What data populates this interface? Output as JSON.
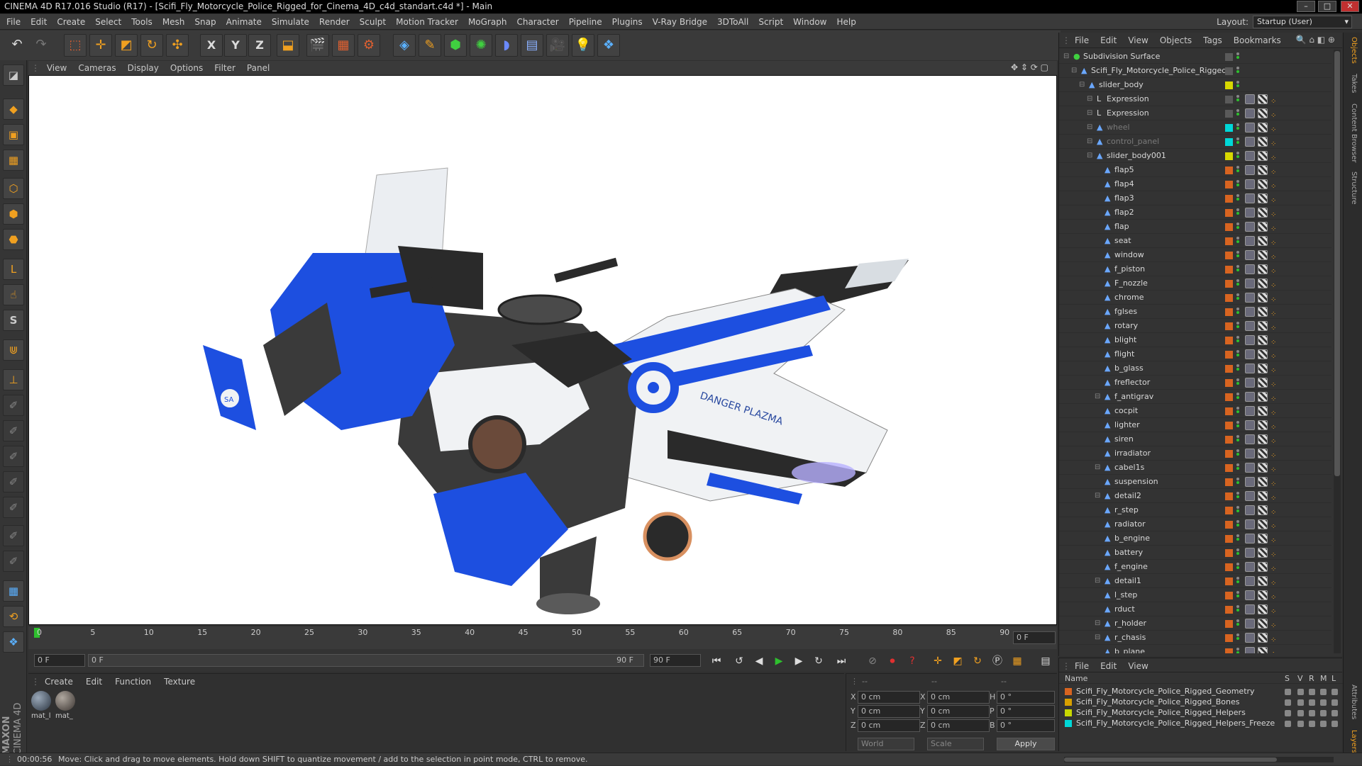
{
  "window": {
    "title": "CINEMA 4D R17.016 Studio (R17) - [Scifi_Fly_Motorcycle_Police_Rigged_for_Cinema_4D_c4d_standart.c4d *] - Main"
  },
  "menu": [
    "File",
    "Edit",
    "Create",
    "Select",
    "Tools",
    "Mesh",
    "Snap",
    "Animate",
    "Simulate",
    "Render",
    "Sculpt",
    "Motion Tracker",
    "MoGraph",
    "Character",
    "Pipeline",
    "Plugins",
    "V-Ray Bridge",
    "3DToAll",
    "Script",
    "Window",
    "Help"
  ],
  "layout": {
    "label": "Layout:",
    "value": "Startup (User)"
  },
  "toolbar": {
    "x": "X",
    "y": "Y",
    "z": "Z"
  },
  "lefttools": {
    "s_label": "S"
  },
  "viewport_menu": [
    "View",
    "Cameras",
    "Display",
    "Options",
    "Filter",
    "Panel"
  ],
  "timeline": {
    "ticks": [
      "0",
      "5",
      "10",
      "15",
      "20",
      "25",
      "30",
      "35",
      "40",
      "45",
      "50",
      "55",
      "60",
      "65",
      "70",
      "75",
      "80",
      "85",
      "90"
    ],
    "end_field": "0 F"
  },
  "playback": {
    "start_field": "0 F",
    "range_start": "0 F",
    "range_end": "90 F",
    "end_field": "90 F"
  },
  "material_menu": [
    "Create",
    "Edit",
    "Function",
    "Texture"
  ],
  "materials": [
    "mat_l",
    "mat_"
  ],
  "coords": {
    "x_pos": "0 cm",
    "y_pos": "0 cm",
    "z_pos": "0 cm",
    "x_size": "0 cm",
    "y_size": "0 cm",
    "z_size": "0 cm",
    "h": "0 °",
    "p": "0 °",
    "b": "0 °",
    "mode": "World",
    "scale": "Scale",
    "apply": "Apply",
    "dashes1": "--",
    "dashes2": "--",
    "dashes3": "--"
  },
  "objects_menu": [
    "File",
    "Edit",
    "View",
    "Objects",
    "Tags",
    "Bookmarks"
  ],
  "objects": [
    {
      "name": "Subdivision Surface",
      "indent": 0,
      "color": "#5a5a5a",
      "grey": false
    },
    {
      "name": "Scifi_Fly_Motorcycle_Police_Rigged",
      "indent": 1,
      "color": "#5a5a5a",
      "grey": false
    },
    {
      "name": "slider_body",
      "indent": 2,
      "color": "#d8d800",
      "grey": false
    },
    {
      "name": "Expression",
      "indent": 3,
      "color": "#5a5a5a",
      "grey": false
    },
    {
      "name": "Expression",
      "indent": 3,
      "color": "#5a5a5a",
      "grey": false
    },
    {
      "name": "wheel",
      "indent": 3,
      "color": "#00d8d8",
      "grey": true
    },
    {
      "name": "control_panel",
      "indent": 3,
      "color": "#00d8d8",
      "grey": true
    },
    {
      "name": "slider_body001",
      "indent": 3,
      "color": "#d8d800",
      "grey": false
    },
    {
      "name": "flap5",
      "indent": 4,
      "color": "#d86420",
      "grey": false
    },
    {
      "name": "flap4",
      "indent": 4,
      "color": "#d86420",
      "grey": false
    },
    {
      "name": "flap3",
      "indent": 4,
      "color": "#d86420",
      "grey": false
    },
    {
      "name": "flap2",
      "indent": 4,
      "color": "#d86420",
      "grey": false
    },
    {
      "name": "flap",
      "indent": 4,
      "color": "#d86420",
      "grey": false
    },
    {
      "name": "seat",
      "indent": 4,
      "color": "#d86420",
      "grey": false
    },
    {
      "name": "window",
      "indent": 4,
      "color": "#d86420",
      "grey": false
    },
    {
      "name": "f_piston",
      "indent": 4,
      "color": "#d86420",
      "grey": false
    },
    {
      "name": "F_nozzle",
      "indent": 4,
      "color": "#d86420",
      "grey": false
    },
    {
      "name": "chrome",
      "indent": 4,
      "color": "#d86420",
      "grey": false
    },
    {
      "name": "fglses",
      "indent": 4,
      "color": "#d86420",
      "grey": false
    },
    {
      "name": "rotary",
      "indent": 4,
      "color": "#d86420",
      "grey": false
    },
    {
      "name": "blight",
      "indent": 4,
      "color": "#d86420",
      "grey": false
    },
    {
      "name": "flight",
      "indent": 4,
      "color": "#d86420",
      "grey": false
    },
    {
      "name": "b_glass",
      "indent": 4,
      "color": "#d86420",
      "grey": false
    },
    {
      "name": "freflector",
      "indent": 4,
      "color": "#d86420",
      "grey": false
    },
    {
      "name": "f_antigrav",
      "indent": 4,
      "color": "#d86420",
      "grey": false
    },
    {
      "name": "cocpit",
      "indent": 4,
      "color": "#d86420",
      "grey": false
    },
    {
      "name": "lighter",
      "indent": 4,
      "color": "#d86420",
      "grey": false
    },
    {
      "name": "siren",
      "indent": 4,
      "color": "#d86420",
      "grey": false
    },
    {
      "name": "irradiator",
      "indent": 4,
      "color": "#d86420",
      "grey": false
    },
    {
      "name": "cabel1s",
      "indent": 4,
      "color": "#d86420",
      "grey": false
    },
    {
      "name": "suspension",
      "indent": 4,
      "color": "#d86420",
      "grey": false
    },
    {
      "name": "detail2",
      "indent": 4,
      "color": "#d86420",
      "grey": false
    },
    {
      "name": "r_step",
      "indent": 4,
      "color": "#d86420",
      "grey": false
    },
    {
      "name": "radiator",
      "indent": 4,
      "color": "#d86420",
      "grey": false
    },
    {
      "name": "b_engine",
      "indent": 4,
      "color": "#d86420",
      "grey": false
    },
    {
      "name": "battery",
      "indent": 4,
      "color": "#d86420",
      "grey": false
    },
    {
      "name": "f_engine",
      "indent": 4,
      "color": "#d86420",
      "grey": false
    },
    {
      "name": "detail1",
      "indent": 4,
      "color": "#d86420",
      "grey": false
    },
    {
      "name": "l_step",
      "indent": 4,
      "color": "#d86420",
      "grey": false
    },
    {
      "name": "rduct",
      "indent": 4,
      "color": "#d86420",
      "grey": false
    },
    {
      "name": "r_holder",
      "indent": 4,
      "color": "#d86420",
      "grey": false
    },
    {
      "name": "r_chasis",
      "indent": 4,
      "color": "#d86420",
      "grey": false
    },
    {
      "name": "b_plane",
      "indent": 4,
      "color": "#d86420",
      "grey": false
    }
  ],
  "layers_menu": [
    "File",
    "Edit",
    "View"
  ],
  "layers_header": {
    "name": "Name",
    "cols": [
      "S",
      "V",
      "R",
      "M",
      "L"
    ]
  },
  "layers": [
    {
      "name": "Scifi_Fly_Motorcycle_Police_Rigged_Geometry",
      "color": "#d86420"
    },
    {
      "name": "Scifi_Fly_Motorcycle_Police_Rigged_Bones",
      "color": "#d8a000"
    },
    {
      "name": "Scifi_Fly_Motorcycle_Police_Rigged_Helpers",
      "color": "#c8d800"
    },
    {
      "name": "Scifi_Fly_Motorcycle_Police_Rigged_Helpers_Freeze",
      "color": "#00d8d8"
    }
  ],
  "right_tabs": [
    "Objects",
    "Takes",
    "Content Browser",
    "Structure",
    "Attributes",
    "Layers"
  ],
  "status": {
    "time": "00:00:56",
    "message": "Move: Click and drag to move elements. Hold down SHIFT to quantize movement / add to the selection in point mode, CTRL to remove."
  },
  "logo": {
    "maxon": "MAXON",
    "cinema": "CINEMA 4D"
  },
  "vehicle": {
    "decal_text": "DANGER PLAZMA",
    "badge": "SA"
  }
}
